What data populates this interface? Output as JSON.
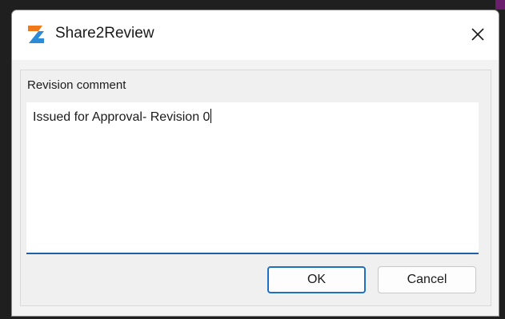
{
  "window": {
    "title": "Share2Review",
    "app_icon": "share2review-logo-icon",
    "close_icon": "close-icon"
  },
  "form": {
    "comment_label": "Revision comment",
    "comment_value": "Issued for Approval- Revision 0"
  },
  "buttons": {
    "ok_label": "OK",
    "cancel_label": "Cancel"
  },
  "colors": {
    "logo_orange": "#f07a1a",
    "logo_blue": "#2b8bd6",
    "focus_accent": "#1f6fc4"
  }
}
